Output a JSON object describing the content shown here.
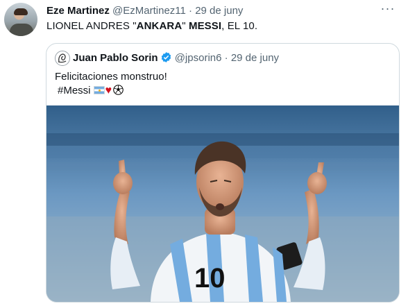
{
  "tweet": {
    "author_name": "Eze Martinez",
    "author_handle": "@EzMartinez11",
    "separator": "·",
    "date": "29 de juny",
    "more_label": "···",
    "text_prefix": "LIONEL ANDRES \"",
    "text_bold1": "ANKARA",
    "text_mid": "\" ",
    "text_bold2": "MESSI",
    "text_suffix": ", EL 10."
  },
  "quoted": {
    "author_name": "Juan Pablo Sorin",
    "author_handle": "@jpsorin6",
    "separator": "·",
    "date": "29 de juny",
    "text": "Felicitaciones monstruo!",
    "hashtag": "#Messi",
    "emojis": [
      "flag-argentina-icon",
      "red-heart-icon",
      "soccer-ball-icon"
    ],
    "jersey_number": "10"
  },
  "colors": {
    "secondary_text": "#536471",
    "border": "#cfd9de",
    "verified": "#1d9bf0",
    "jersey_sky_blue": "#74acdf"
  }
}
